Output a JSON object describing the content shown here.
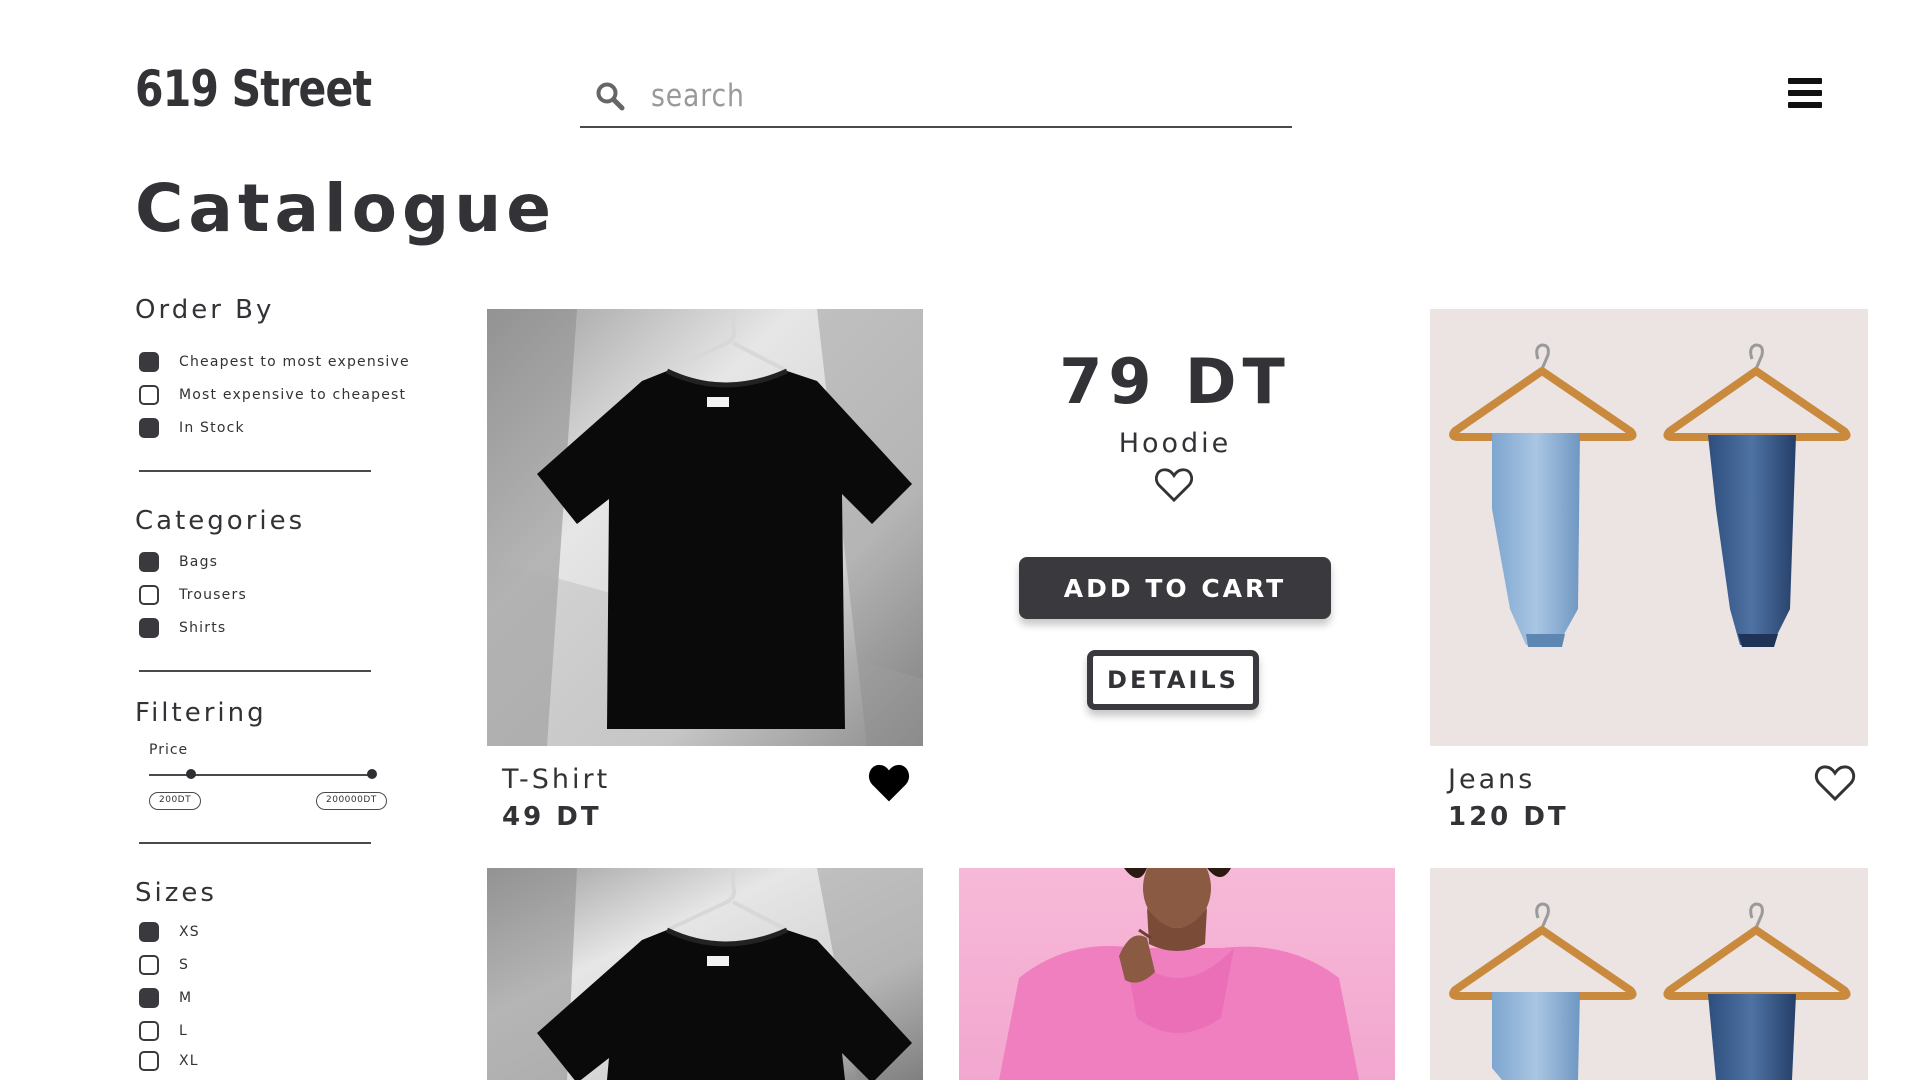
{
  "header": {
    "logo": "619 Street",
    "search_placeholder": "search",
    "menu_icon": "hamburger-menu-icon"
  },
  "page_title": "Catalogue",
  "sidebar": {
    "order_by": {
      "heading": "Order By",
      "options": [
        {
          "label": "Cheapest to most expensive",
          "checked": true
        },
        {
          "label": "Most expensive to cheapest",
          "checked": false
        },
        {
          "label": "In Stock",
          "checked": true
        }
      ]
    },
    "categories": {
      "heading": "Categories",
      "options": [
        {
          "label": "Bags",
          "checked": true
        },
        {
          "label": "Trousers",
          "checked": false
        },
        {
          "label": "Shirts",
          "checked": true
        }
      ]
    },
    "filtering": {
      "heading": "Filtering",
      "price_label": "Price",
      "min_label": "200DT",
      "max_label": "200000DT"
    },
    "sizes": {
      "heading": "Sizes",
      "options": [
        {
          "label": "XS",
          "checked": true
        },
        {
          "label": "S",
          "checked": false
        },
        {
          "label": "M",
          "checked": true
        },
        {
          "label": "L",
          "checked": false
        },
        {
          "label": "XL",
          "checked": false
        }
      ]
    }
  },
  "products": [
    {
      "name": "T-Shirt",
      "price": "49 DT",
      "favorite": true,
      "image": "black-tshirt-photo"
    },
    {
      "name": "Hoodie",
      "price": "79 DT",
      "favorite": false,
      "image": "pink-hoodie-photo",
      "hovered": true
    },
    {
      "name": "Jeans",
      "price": "120 DT",
      "favorite": false,
      "image": "jeans-on-hangers-photo"
    },
    {
      "image": "black-tshirt-photo"
    },
    {
      "image": "pink-hoodie-photo"
    },
    {
      "image": "jeans-on-hangers-photo"
    }
  ],
  "hover_card": {
    "add_to_cart": "ADD TO CART",
    "details": "DETAILS"
  },
  "colors": {
    "text": "#333337",
    "button_dark": "#3a3a3e",
    "hoodie_pink": "#f2a0d0",
    "background": "#ffffff"
  }
}
